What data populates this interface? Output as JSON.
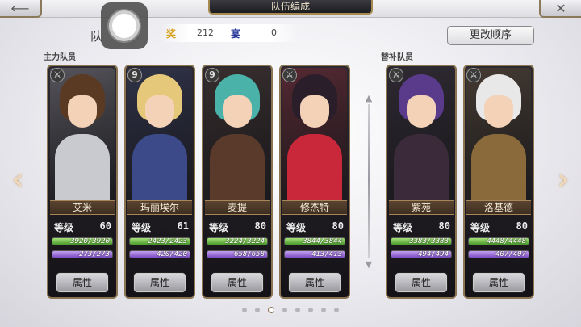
{
  "header": {
    "title": "队伍编成",
    "team_label": "队",
    "stat1_icon": "奖",
    "stat1_value": "212",
    "stat2_icon": "宴",
    "stat2_value": "0",
    "reorder_label": "更改顺序"
  },
  "sections": {
    "main_label": "主力队员",
    "reserve_label": "替补队员"
  },
  "pagination": {
    "total": 8,
    "active_index": 2
  },
  "colors": {
    "hp_fill": "#6cbf3c",
    "sp_fill": "#9a6ad8",
    "frame_gold": "#8a7452"
  },
  "cards": [
    {
      "name": "艾米",
      "level_label": "等级",
      "level": "60",
      "hp": "3920/3920",
      "sp": "273/273",
      "attr_label": "属性",
      "badge": "",
      "hair": "#5a3a22",
      "outfit": "#c9c9d0"
    },
    {
      "name": "玛丽埃尔",
      "level_label": "等级",
      "level": "61",
      "hp": "2423/2423",
      "sp": "420/420",
      "attr_label": "属性",
      "badge": "9",
      "hair": "#e6c87a",
      "outfit": "#3c4a8a"
    },
    {
      "name": "麦提",
      "level_label": "等级",
      "level": "80",
      "hp": "3224/3224",
      "sp": "658/658",
      "attr_label": "属性",
      "badge": "9",
      "hair": "#4ab2a8",
      "outfit": "#5a3a2a"
    },
    {
      "name": "修杰特",
      "level_label": "等级",
      "level": "80",
      "hp": "3844/3844",
      "sp": "413/413",
      "attr_label": "属性",
      "badge": "",
      "hair": "#2a1e2a",
      "outfit": "#c8283a"
    },
    {
      "name": "紫苑",
      "level_label": "等级",
      "level": "80",
      "hp": "3383/3383",
      "sp": "494/494",
      "attr_label": "属性",
      "badge": "",
      "hair": "#5a3a8a",
      "outfit": "#3a2a3a"
    },
    {
      "name": "洛基德",
      "level_label": "等级",
      "level": "80",
      "hp": "4448/4448",
      "sp": "407/407",
      "attr_label": "属性",
      "badge": "",
      "hair": "#e8e8e8",
      "outfit": "#8a6a3a"
    }
  ]
}
